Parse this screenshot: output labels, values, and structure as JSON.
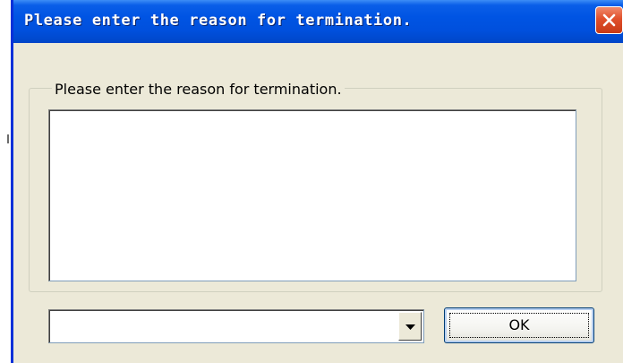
{
  "window": {
    "title": "Please enter the reason for termination."
  },
  "icons": {
    "close": "close-icon",
    "dropdown": "chevron-down-icon"
  },
  "colors": {
    "titlebar": "#0054e3",
    "close_button": "#e0502c",
    "dialog_background": "#ece9d8",
    "ok_border": "#003c74"
  },
  "groupbox": {
    "label": "Please enter the reason for termination."
  },
  "reason_text": {
    "value": ""
  },
  "reason_select": {
    "selected": ""
  },
  "ok_button": {
    "label": "OK"
  }
}
